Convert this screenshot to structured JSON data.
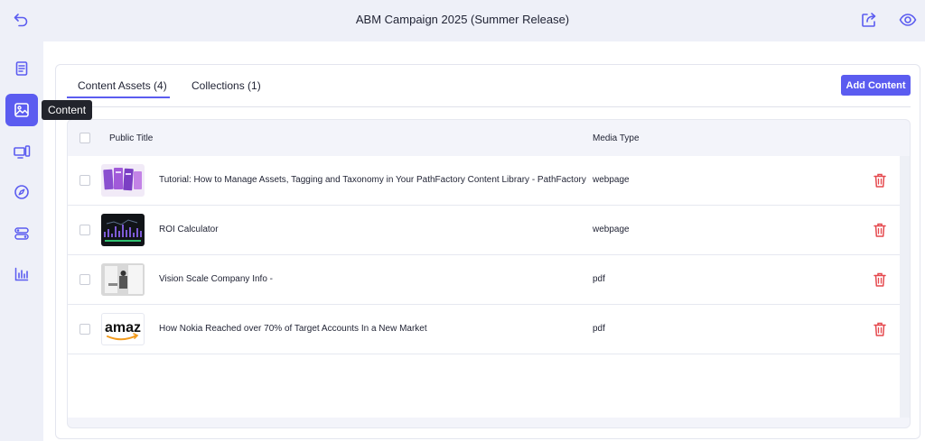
{
  "header": {
    "title": "ABM Campaign 2025 (Summer Release)"
  },
  "sidebar": {
    "tooltip": "Content",
    "items": [
      {
        "icon": "document-icon"
      },
      {
        "icon": "image-icon",
        "active": true
      },
      {
        "icon": "devices-icon"
      },
      {
        "icon": "compass-icon"
      },
      {
        "icon": "toggles-icon"
      },
      {
        "icon": "bar-chart-icon"
      }
    ]
  },
  "tabs": [
    {
      "label": "Content Assets (4)",
      "active": true
    },
    {
      "label": "Collections (1)",
      "active": false
    }
  ],
  "toolbar": {
    "add_label": "Add Content"
  },
  "table": {
    "columns": [
      "Public Title",
      "Media Type"
    ],
    "rows": [
      {
        "title": "Tutorial: How to Manage Assets, Tagging and Taxonomy in Your PathFactory Content Library - PathFactory",
        "media": "webpage",
        "thumb": "purple-cards"
      },
      {
        "title": "ROI Calculator",
        "media": "webpage",
        "thumb": "dark-chart"
      },
      {
        "title": "Vision Scale Company Info -",
        "media": "pdf",
        "thumb": "office-photo"
      },
      {
        "title": "How Nokia Reached over 70% of Target Accounts In a New Market",
        "media": "pdf",
        "thumb": "amazon-logo",
        "thumb_text": "amaz"
      }
    ]
  },
  "colors": {
    "accent": "#5b5cf0",
    "danger": "#e5484d",
    "background": "#eef0f8"
  }
}
